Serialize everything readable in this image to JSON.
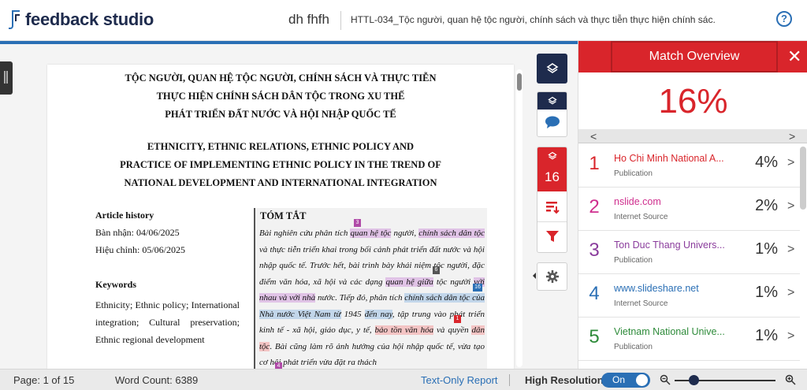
{
  "app": {
    "name": "feedback studio"
  },
  "header": {
    "student": "dh fhfh",
    "doc_title": "HTTL-034_Tộc người, quan hệ tộc người, chính sách và thực tiễn thực hiện chính sác...",
    "help": "?"
  },
  "document": {
    "vn_title": [
      "TỘC NGƯỜI, QUAN HỆ TỘC NGƯỜI, CHÍNH SÁCH VÀ THỰC TIỄN",
      "THỰC HIỆN CHÍNH SÁCH DÂN TỘC TRONG XU THẾ",
      "PHÁT TRIỂN ĐẤT NƯỚC VÀ HỘI NHẬP QUỐC TẾ"
    ],
    "en_title": [
      "ETHNICITY, ETHNIC RELATIONS, ETHNIC POLICY AND",
      "PRACTICE OF IMPLEMENTING ETHNIC POLICY IN THE TREND OF",
      "NATIONAL DEVELOPMENT AND INTERNATIONAL INTEGRATION"
    ],
    "article_history_label": "Article history",
    "received": "Bàn nhận: 04/06/2025",
    "revised": "Hiệu chỉnh: 05/06/2025",
    "keywords_label": "Keywords",
    "keywords_text": "Ethnicity; Ethnic policy; International integration; Cultural preservation; Ethnic regional development",
    "abstract_title": "TÓM TẮT",
    "abstract_segments": [
      {
        "text": "Bài nghiên cứu phân tích ",
        "hl": ""
      },
      {
        "text": "quan hệ tộc",
        "hl": "hp"
      },
      {
        "text": " người, ",
        "hl": ""
      },
      {
        "text": "chính sách dân tộc",
        "hl": "hp"
      },
      {
        "text": " và thực tiễn triển khai trong bối cảnh phát triển đất nước và hội nhập quốc tế. Trước hết, bài trình bày khái niệm tộc người, đặc điểm văn hóa, xã hội và các dạng ",
        "hl": ""
      },
      {
        "text": "quan hệ giữa",
        "hl": "hp"
      },
      {
        "text": " tộc người ",
        "hl": ""
      },
      {
        "text": "với nhau và với nhà",
        "hl": "hp"
      },
      {
        "text": " nước. Tiếp đó, phân tích ",
        "hl": ""
      },
      {
        "text": "chính sách dân tộc của Nhà nước Việt Nam từ",
        "hl": "hb"
      },
      {
        "text": " 1945 ",
        "hl": ""
      },
      {
        "text": "đến nay",
        "hl": "hb"
      },
      {
        "text": ", tập trung vào phát triển kinh tế - xã hội, giáo dục, y tế, ",
        "hl": ""
      },
      {
        "text": "bảo tồn văn hóa",
        "hl": "hr"
      },
      {
        "text": " và quyền ",
        "hl": ""
      },
      {
        "text": "dân tộc",
        "hl": "hr"
      },
      {
        "text": ". Bài cũng làm rõ ảnh hưởng của hội nhập quốc tế, vừa tạo cơ hội phát triển vừa đặt ra thách",
        "hl": ""
      }
    ],
    "markers": [
      "3",
      "6",
      "16",
      "1",
      "4"
    ]
  },
  "tools": {
    "match_count": "16"
  },
  "panel": {
    "title": "Match Overview",
    "close": "✕",
    "overall": "16%",
    "nav_prev": "<",
    "nav_next": ">",
    "matches": [
      {
        "num": "1",
        "name": "Ho Chi Minh National A...",
        "type": "Publication",
        "pct": "4%",
        "color": "#d9252b"
      },
      {
        "num": "2",
        "name": "nslide.com",
        "type": "Internet Source",
        "pct": "2%",
        "color": "#cf2f8e"
      },
      {
        "num": "3",
        "name": "Ton Duc Thang Univers...",
        "type": "Publication",
        "pct": "1%",
        "color": "#8a3c9c"
      },
      {
        "num": "4",
        "name": "www.slideshare.net",
        "type": "Internet Source",
        "pct": "1%",
        "color": "#2a6fb5"
      },
      {
        "num": "5",
        "name": "Vietnam National Unive...",
        "type": "Publication",
        "pct": "1%",
        "color": "#2e8b3a"
      }
    ]
  },
  "status": {
    "page": "Page: 1 of 15",
    "words": "Word Count: 6389",
    "text_only": "Text-Only Report",
    "high_res": "High Resolution",
    "toggle": "On"
  }
}
